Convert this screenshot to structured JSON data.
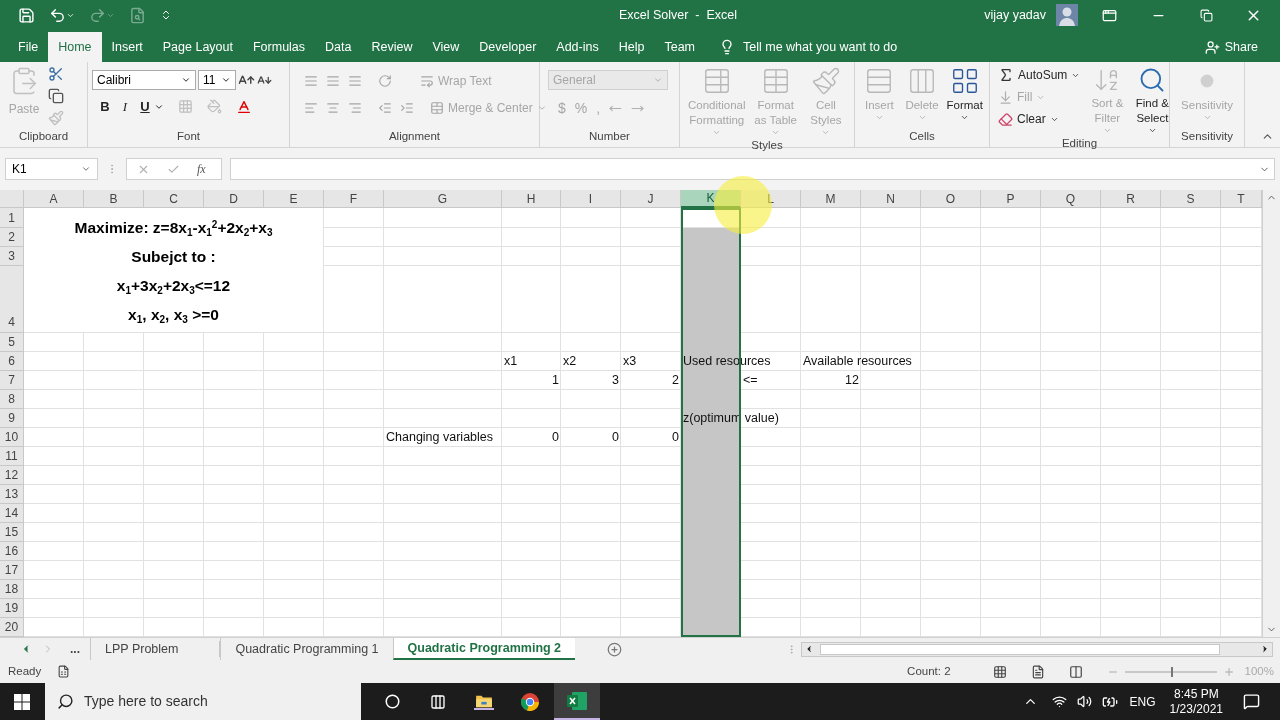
{
  "title_bar": {
    "title": "Excel Solver  -  Excel",
    "user": "vijay yadav"
  },
  "menu_tabs": [
    {
      "label": "File",
      "selected": false
    },
    {
      "label": "Home",
      "selected": true
    },
    {
      "label": "Insert",
      "selected": false
    },
    {
      "label": "Page Layout",
      "selected": false
    },
    {
      "label": "Formulas",
      "selected": false
    },
    {
      "label": "Data",
      "selected": false
    },
    {
      "label": "Review",
      "selected": false
    },
    {
      "label": "View",
      "selected": false
    },
    {
      "label": "Developer",
      "selected": false
    },
    {
      "label": "Add-ins",
      "selected": false
    },
    {
      "label": "Help",
      "selected": false
    },
    {
      "label": "Team",
      "selected": false
    }
  ],
  "tell_me": "Tell me what you want to do",
  "share": "Share",
  "ribbon_groups": [
    {
      "kind": "clipboard",
      "label": "Clipboard",
      "items": [
        {
          "label": "Paste",
          "disabled": true
        }
      ]
    },
    {
      "kind": "font",
      "label": "Font",
      "font_name": "Calibri",
      "font_size": "11",
      "items": [
        {
          "label": "B",
          "disabled": false
        },
        {
          "label": "I",
          "disabled": false
        },
        {
          "label": "U",
          "disabled": false
        }
      ]
    },
    {
      "kind": "alignment",
      "label": "Alignment",
      "items": [
        {
          "label": "Wrap Text",
          "disabled": true
        },
        {
          "label": "Merge & Center",
          "disabled": true
        }
      ]
    },
    {
      "kind": "number",
      "label": "Number",
      "format": "General",
      "items": [
        {
          "label": "$",
          "disabled": true
        },
        {
          "label": "%",
          "disabled": true
        },
        {
          "label": ",",
          "disabled": true
        }
      ]
    },
    {
      "kind": "styles",
      "label": "Styles",
      "items": [
        {
          "label": "Conditional Formatting",
          "disabled": true
        },
        {
          "label": "Format as Table",
          "disabled": true
        },
        {
          "label": "Cell Styles",
          "disabled": true
        }
      ]
    },
    {
      "kind": "cells",
      "label": "Cells",
      "items": [
        {
          "label": "Insert",
          "disabled": true
        },
        {
          "label": "Delete",
          "disabled": true
        },
        {
          "label": "Format",
          "disabled": false
        }
      ]
    },
    {
      "kind": "editing",
      "label": "Editing",
      "items": [
        {
          "label": "AutoSum",
          "disabled": false
        },
        {
          "label": "Fill",
          "disabled": true
        },
        {
          "label": "Clear",
          "disabled": false
        },
        {
          "label": "Sort & Filter",
          "disabled": true
        },
        {
          "label": "Find & Select",
          "disabled": false
        }
      ]
    },
    {
      "kind": "sensitivity",
      "label": "Sensitivity",
      "items": [
        {
          "label": "Sensitivity",
          "disabled": true
        }
      ]
    }
  ],
  "formula_bar": {
    "name_box": "K1",
    "function_label": "fx"
  },
  "sheet": {
    "columns": [
      {
        "label": "A",
        "selected": false
      },
      {
        "label": "B",
        "selected": false
      },
      {
        "label": "C",
        "selected": false
      },
      {
        "label": "D",
        "selected": false
      },
      {
        "label": "E",
        "selected": false
      },
      {
        "label": "F",
        "selected": false
      },
      {
        "label": "G",
        "selected": false
      },
      {
        "label": "H",
        "selected": false
      },
      {
        "label": "I",
        "selected": false
      },
      {
        "label": "J",
        "selected": false
      },
      {
        "label": "K",
        "selected": true
      },
      {
        "label": "L",
        "selected": false
      },
      {
        "label": "M",
        "selected": false
      },
      {
        "label": "N",
        "selected": false
      },
      {
        "label": "O",
        "selected": false
      },
      {
        "label": "P",
        "selected": false
      },
      {
        "label": "Q",
        "selected": false
      },
      {
        "label": "R",
        "selected": false
      },
      {
        "label": "S",
        "selected": false
      },
      {
        "label": "T",
        "selected": false
      }
    ],
    "merged_text": [
      "Maximize: z=8x$_{1}$-x$_{1}$$^{2}$+2x$_{2}$+x$_{3}$",
      "Subejct to :",
      "x$_{1}$+3x$_{2}$+2x$_{3}$<=12",
      "x$_{1}$, x$_{2}$, x$_{3}$ >=0"
    ],
    "rows": [
      {
        "label": "1"
      },
      {
        "label": "2"
      },
      {
        "label": "3"
      },
      {
        "label": "4"
      },
      {
        "label": "5"
      },
      {
        "label": "6",
        "cells": {
          "H": "x1",
          "I": "x2",
          "J": "x3",
          "K": "Used resources",
          "M": "Available resources"
        }
      },
      {
        "label": "7",
        "cells": {
          "H": "1",
          "I": "3",
          "J": "2",
          "L": "<=",
          "M": "12"
        }
      },
      {
        "label": "8"
      },
      {
        "label": "9",
        "cells": {
          "K": "z(optimum value)"
        }
      },
      {
        "label": "10",
        "cells": {
          "G": "Changing variables",
          "H": "0",
          "I": "0",
          "J": "0"
        }
      },
      {
        "label": "11"
      },
      {
        "label": "12"
      },
      {
        "label": "13"
      },
      {
        "label": "14"
      },
      {
        "label": "15"
      },
      {
        "label": "16"
      },
      {
        "label": "17"
      },
      {
        "label": "18"
      },
      {
        "label": "19"
      },
      {
        "label": "20"
      }
    ]
  },
  "sheet_tabs": {
    "more": "...",
    "tabs": [
      {
        "label": "LPP Problem",
        "selected": false
      },
      {
        "label": "Quadratic Programming 1",
        "selected": false
      },
      {
        "label": "Quadratic Programming 2",
        "selected": true
      }
    ]
  },
  "status_bar": {
    "ready": "Ready",
    "count": "Count: 2",
    "zoom": {
      "label": "100%",
      "level": 0.5
    }
  },
  "taskbar": {
    "search_placeholder": "Type here to search",
    "language": "ENG",
    "time": "8:45 PM",
    "date": "1/23/2021"
  }
}
